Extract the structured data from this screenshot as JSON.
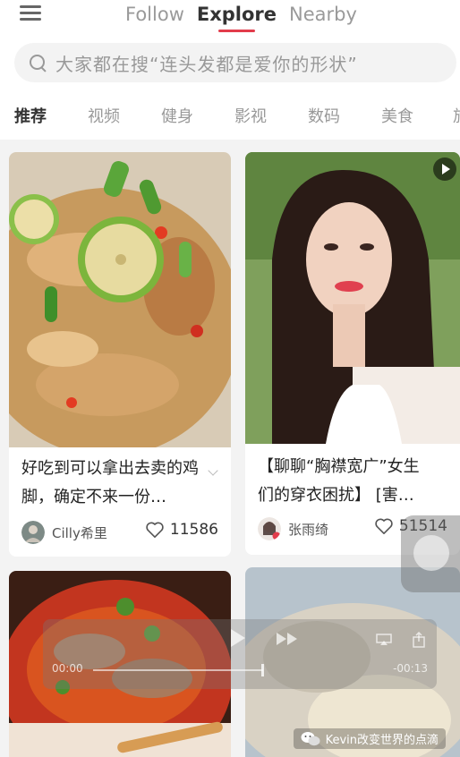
{
  "header": {
    "tabs": [
      {
        "label": "Follow",
        "active": false
      },
      {
        "label": "Explore",
        "active": true
      },
      {
        "label": "Nearby",
        "active": false
      }
    ],
    "accent_color": "#e23c4b"
  },
  "search": {
    "placeholder": "大家都在搜“连头发都是爱你的形状”"
  },
  "categories": [
    {
      "label": "推荐",
      "active": true
    },
    {
      "label": "视频",
      "active": false
    },
    {
      "label": "健身",
      "active": false
    },
    {
      "label": "影视",
      "active": false
    },
    {
      "label": "数码",
      "active": false
    },
    {
      "label": "美食",
      "active": false
    },
    {
      "label": "旅",
      "active": false
    }
  ],
  "feed": {
    "cards": [
      {
        "title": "好吃到可以拿出去卖的鸡脚，确定不来一份…",
        "author": "Cilly希里",
        "likes": "11586",
        "image": "food-chicken-feet-photo"
      },
      {
        "title": "【聊聊“胸襟宽广”女生们的穿衣困扰】 [害…",
        "author": "张雨绮",
        "likes": "51514",
        "image": "woman-portrait-video-thumbnail",
        "is_video": true
      },
      {
        "image": "spicy-beef-dish-photo"
      },
      {
        "image": "video-thumbnail-food"
      }
    ]
  },
  "video_player": {
    "elapsed": "00:00",
    "remaining": "-00:13"
  },
  "watermark": {
    "text": "Kevin改变世界的点滴"
  }
}
